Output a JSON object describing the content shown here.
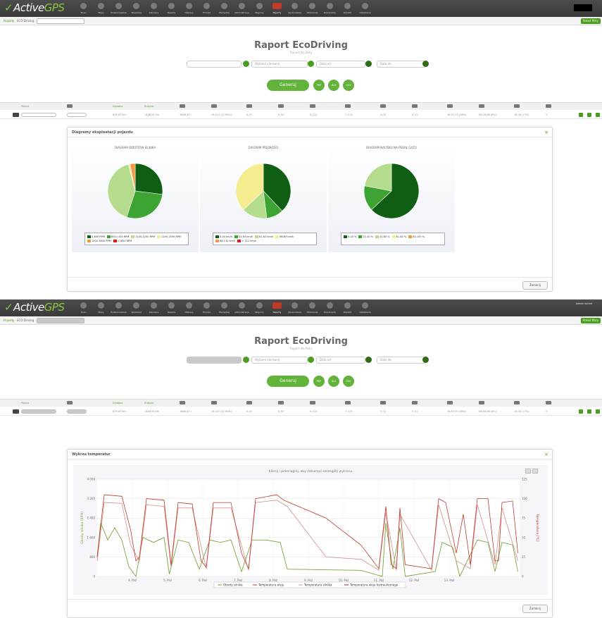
{
  "app": {
    "logo_prefix": "Active",
    "logo_suffix": "GPS",
    "nav": [
      "Teren",
      "Mapy",
      "Podsumowanie",
      "Wyszukaj",
      "Kierowcy",
      "Pojazdy",
      "Obszary",
      "Prompt",
      "Zarządzaj",
      "Administracja",
      "Regiony",
      "Raporty",
      "Uprawnienia",
      "Obliczenia",
      "Dokumenty",
      "Kontakt",
      "Ustawienia"
    ],
    "active_nav_index": 11,
    "filter_button": "Pokaż filtry",
    "object_label": "Pojazdy",
    "eco_label": "ECO Driving",
    "user_name": "Admin Active"
  },
  "report": {
    "title": "Raport EcoDriving",
    "subtitle": "Raport dla floty",
    "fields": [
      "",
      "Wybierz kierowcę",
      "Data od",
      "Data do"
    ],
    "generate": "Generuj",
    "buttons": [
      "PDF",
      "XLS",
      "CSV"
    ]
  },
  "table": {
    "headers": [
      "Pojazd",
      "",
      "Dystans",
      "Zużycie",
      "",
      "",
      "",
      "",
      "",
      "",
      "",
      "",
      "",
      "",
      "",
      ""
    ],
    "row": [
      "",
      "",
      "679,07 km",
      "1448,54 km",
      "1808,43 l",
      "16,24 l (27,90%)",
      "0,25",
      "0,30",
      "0 (12)",
      "7 (17)",
      "4 (1)",
      "0 (1)",
      "18:37:19 (38%)",
      "08:18:36 (8%)",
      "16,78 l (7%)",
      "3"
    ]
  },
  "modal1": {
    "title": "Diagramy eksploatacji pojazdu",
    "close_button": "Zamknij",
    "charts": [
      {
        "title": "DIAGRAM OBROTÓW SILNIKA",
        "legend": [
          "0-800 RPM",
          "800-1100 RPM",
          "1100-1200 RPM",
          "1200-1500 RPM",
          "1500-1800 RPM",
          ">1800 RPM"
        ],
        "colors": [
          "#0f5e14",
          "#3da332",
          "#b5dc8c",
          "#f4ec8e",
          "#f29a40",
          "#d51f1f"
        ]
      },
      {
        "title": "DIAGRAM PRĘDKOŚCI",
        "legend": [
          "0-40 km/h",
          "41-63 km/h",
          "61-65 km/h",
          "66-85 km/h",
          "86-110 km/h",
          "> 111 km/h"
        ],
        "colors": [
          "#0f5e14",
          "#3da332",
          "#b5dc8c",
          "#f4ec8e",
          "#f29a40",
          "#d51f1f"
        ]
      },
      {
        "title": "DIAGRAM NACISKU NA PEDAŁ GAZU",
        "legend": [
          "0-20 %",
          "21-40 %",
          "41-60 %",
          "61-80 %",
          "81-100 %"
        ],
        "colors": [
          "#0f5e14",
          "#3da332",
          "#b5dc8c",
          "#f4ec8e",
          "#f29a40"
        ]
      }
    ]
  },
  "modal2": {
    "title": "Wykres temperatur",
    "close_button": "Zamknij",
    "chart_title": "Kliknij i przeciągnij, aby zobaczyć szczegóły wykresu",
    "y_left_label": "Obroty silnika [RPM]",
    "y_right_label": "Temperatura [°C]",
    "y_left_ticks": [
      "0",
      "800",
      "1 600",
      "2 400",
      "3 200",
      "4 000"
    ],
    "y_right_ticks": [
      "0",
      "25",
      "50",
      "75",
      "100",
      "125"
    ],
    "x_ticks": [
      "4. Paź",
      "5. Paź",
      "6. Paź",
      "7. Paź",
      "8. Paź",
      "9. Paź",
      "10. Paź",
      "11. Paź",
      "12. Paź",
      "13. Paź"
    ],
    "legend": [
      "Obroty silnika",
      "Temperatura oleju",
      "Temperatura silnika",
      "Temperatura oleju hydraulicznego"
    ],
    "colors": {
      "rpm": "#7aa53d",
      "oil": "#c0392b",
      "engine": "#d98a8a",
      "hydraulic": "#8b2f2f"
    }
  },
  "chart_data": [
    {
      "type": "pie",
      "title": "DIAGRAM OBROTÓW SILNIKA",
      "categories": [
        "0-800 RPM",
        "800-1100 RPM",
        "1100-1200 RPM",
        "1200-1500 RPM",
        "1500-1800 RPM",
        ">1800 RPM"
      ],
      "values": [
        27,
        28,
        41,
        1,
        3,
        0
      ]
    },
    {
      "type": "pie",
      "title": "DIAGRAM PRĘDKOŚCI",
      "categories": [
        "0-40 km/h",
        "41-63 km/h",
        "61-65 km/h",
        "66-85 km/h",
        "86-110 km/h",
        "> 111 km/h"
      ],
      "values": [
        38,
        10,
        15,
        37,
        0,
        0
      ]
    },
    {
      "type": "pie",
      "title": "DIAGRAM NACISKU NA PEDAŁ GAZU",
      "categories": [
        "0-20 %",
        "21-40 %",
        "41-60 %",
        "61-80 %",
        "81-100 %"
      ],
      "values": [
        63,
        15,
        22,
        0,
        0
      ]
    },
    {
      "type": "line",
      "title": "Kliknij i przeciągnij, aby zobaczyć szczegóły wykresu",
      "xlabel": "",
      "ylabel": "Obroty silnika [RPM]",
      "y2label": "Temperatura [°C]",
      "x": [
        "4. Paź",
        "5. Paź",
        "6. Paź",
        "7. Paź",
        "8. Paź",
        "9. Paź",
        "10. Paź",
        "11. Paź",
        "12. Paź",
        "13. Paź"
      ],
      "ylim": [
        0,
        4000
      ],
      "y2lim": [
        0,
        125
      ],
      "series": [
        {
          "name": "Temperatura oleju",
          "axis": "right",
          "points": [
            [
              3.0,
              25
            ],
            [
              3.2,
              105
            ],
            [
              3.7,
              103
            ],
            [
              3.95,
              60
            ],
            [
              4.1,
              20
            ],
            [
              4.2,
              25
            ],
            [
              4.4,
              100
            ],
            [
              4.9,
              98
            ],
            [
              5.1,
              15
            ],
            [
              5.3,
              95
            ],
            [
              5.7,
              93
            ],
            [
              5.95,
              20
            ],
            [
              6.1,
              12
            ],
            [
              6.3,
              95
            ],
            [
              6.8,
              95
            ],
            [
              7.1,
              30
            ],
            [
              7.3,
              10
            ],
            [
              7.5,
              100
            ],
            [
              8.1,
              105
            ],
            [
              8.3,
              98
            ],
            [
              9.5,
              75
            ],
            [
              10.5,
              40
            ],
            [
              11.0,
              10
            ],
            [
              11.2,
              90
            ],
            [
              11.35,
              15
            ],
            [
              11.5,
              10
            ],
            [
              11.6,
              88
            ],
            [
              11.75,
              15
            ],
            [
              12.5,
              10
            ],
            [
              12.7,
              100
            ],
            [
              12.9,
              95
            ],
            [
              13.2,
              30
            ],
            [
              13.4,
              80
            ],
            [
              13.6,
              15
            ],
            [
              13.8,
              100
            ],
            [
              14.1,
              100
            ],
            [
              14.3,
              20
            ],
            [
              14.4,
              20
            ],
            [
              14.5,
              95
            ],
            [
              14.8,
              97
            ],
            [
              14.95,
              30
            ]
          ]
        },
        {
          "name": "Temperatura silnika",
          "axis": "right",
          "points": [
            [
              3.0,
              20
            ],
            [
              3.2,
              95
            ],
            [
              3.7,
              94
            ],
            [
              3.95,
              40
            ],
            [
              4.2,
              20
            ],
            [
              4.4,
              92
            ],
            [
              4.9,
              90
            ],
            [
              5.1,
              12
            ],
            [
              5.3,
              88
            ],
            [
              5.7,
              88
            ],
            [
              6.1,
              10
            ],
            [
              6.3,
              88
            ],
            [
              6.8,
              88
            ],
            [
              7.3,
              8
            ],
            [
              7.5,
              95
            ],
            [
              8.1,
              98
            ],
            [
              8.4,
              90
            ],
            [
              9.5,
              25
            ],
            [
              10.5,
              22
            ],
            [
              11.0,
              8
            ],
            [
              11.2,
              82
            ],
            [
              11.5,
              8
            ],
            [
              11.6,
              80
            ],
            [
              12.5,
              8
            ],
            [
              12.7,
              92
            ],
            [
              13.2,
              20
            ],
            [
              13.6,
              10
            ],
            [
              13.8,
              92
            ],
            [
              14.3,
              15
            ],
            [
              14.5,
              88
            ],
            [
              14.95,
              20
            ]
          ]
        },
        {
          "name": "Obroty silnika",
          "axis": "left",
          "points": [
            [
              3.0,
              800
            ],
            [
              3.1,
              2200
            ],
            [
              3.3,
              1500
            ],
            [
              3.5,
              2000
            ],
            [
              3.7,
              1500
            ],
            [
              3.9,
              400
            ],
            [
              4.1,
              0
            ],
            [
              4.3,
              1600
            ],
            [
              4.6,
              1400
            ],
            [
              4.9,
              1600
            ],
            [
              5.05,
              100
            ],
            [
              5.3,
              1500
            ],
            [
              5.6,
              1400
            ],
            [
              5.9,
              300
            ],
            [
              6.2,
              1500
            ],
            [
              6.5,
              1400
            ],
            [
              6.8,
              1500
            ],
            [
              7.1,
              200
            ],
            [
              7.4,
              1500
            ],
            [
              7.8,
              1500
            ],
            [
              8.2,
              1400
            ],
            [
              8.4,
              300
            ],
            [
              10.5,
              250
            ],
            [
              11.1,
              0
            ],
            [
              11.2,
              2200
            ],
            [
              11.4,
              300
            ],
            [
              11.6,
              2000
            ],
            [
              11.75,
              0
            ],
            [
              12.6,
              200
            ],
            [
              12.8,
              1400
            ],
            [
              13.1,
              1200
            ],
            [
              13.3,
              0
            ],
            [
              13.8,
              1500
            ],
            [
              14.1,
              1400
            ],
            [
              14.3,
              200
            ],
            [
              14.5,
              1400
            ],
            [
              14.8,
              1300
            ],
            [
              14.95,
              200
            ]
          ]
        }
      ]
    }
  ]
}
